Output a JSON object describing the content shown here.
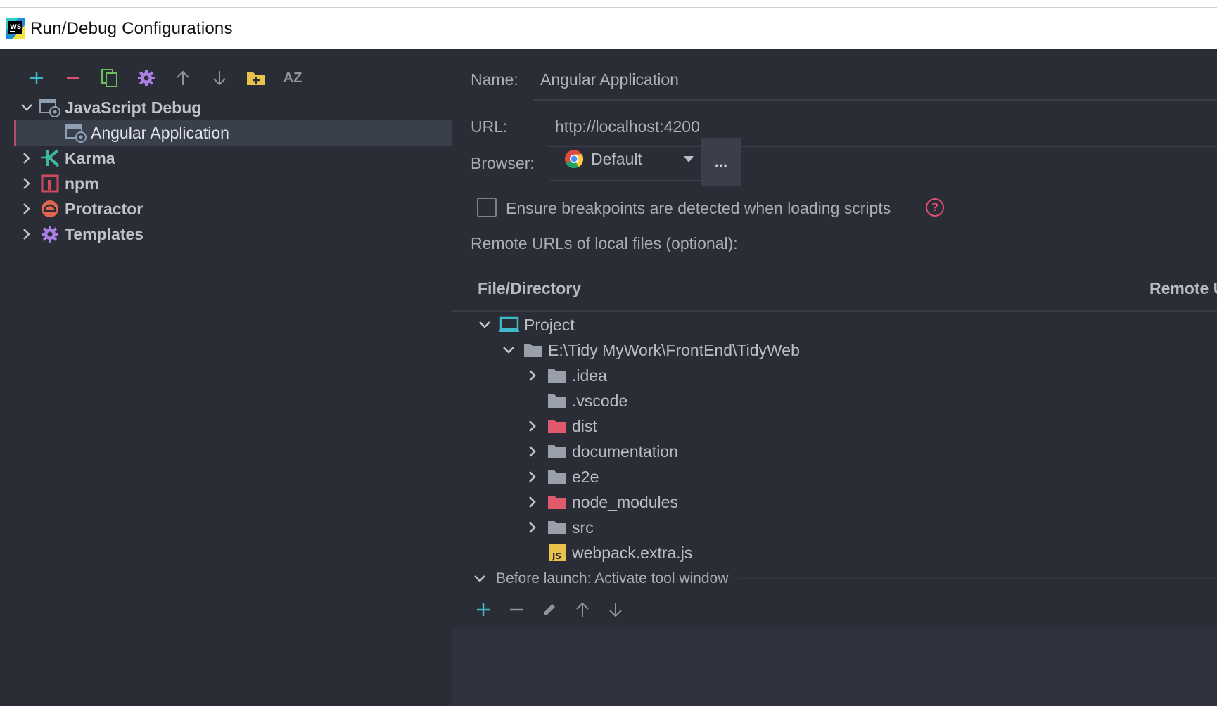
{
  "window": {
    "title": "Run/Debug Configurations"
  },
  "toolbar": {
    "items": [
      "add-icon",
      "remove-icon",
      "copy-icon",
      "gear-icon",
      "arrow-up-icon",
      "arrow-down-icon",
      "new-folder-icon",
      "sort-az-icon"
    ],
    "sort_label": "AZ"
  },
  "tree": {
    "root_label": "JavaScript Debug",
    "selected_label": "Angular Application",
    "items": [
      {
        "label": "Karma",
        "icon": "karma-icon"
      },
      {
        "label": "npm",
        "icon": "npm-icon"
      },
      {
        "label": "Protractor",
        "icon": "protractor-icon"
      },
      {
        "label": "Templates",
        "icon": "gear-icon"
      }
    ]
  },
  "form": {
    "name_label": "Name:",
    "name_value": "Angular Application",
    "url_label": "URL:",
    "url_value": "http://localhost:4200",
    "browser_label": "Browser:",
    "browser_value": "Default",
    "browse_button": "...",
    "checkbox_label": "Ensure breakpoints are detected when loading scripts",
    "help": "?",
    "remote_urls_label": "Remote URLs of local files (optional):"
  },
  "table": {
    "col1": "File/Directory",
    "col2": "Remote U"
  },
  "files": {
    "project": "Project",
    "root": "E:\\Tidy MyWork\\FrontEnd\\TidyWeb",
    "children": [
      {
        "name": ".idea",
        "expandable": true,
        "color": "#9aa0aa"
      },
      {
        "name": ".vscode",
        "expandable": false,
        "color": "#9aa0aa"
      },
      {
        "name": "dist",
        "expandable": true,
        "color": "#e05a6e"
      },
      {
        "name": "documentation",
        "expandable": true,
        "color": "#9aa0aa"
      },
      {
        "name": "e2e",
        "expandable": true,
        "color": "#9aa0aa"
      },
      {
        "name": "node_modules",
        "expandable": true,
        "color": "#e05a6e"
      },
      {
        "name": "src",
        "expandable": true,
        "color": "#9aa0aa"
      },
      {
        "name": "webpack.extra.js",
        "expandable": false,
        "color": "#e8c24a"
      }
    ]
  },
  "before_launch": {
    "label": "Before launch: Activate tool window"
  },
  "colors": {
    "accent_add": "#3fb8c8",
    "accent_remove": "#e0506e",
    "gear": "#a97fe6",
    "folder_special": "#e8c24a"
  }
}
